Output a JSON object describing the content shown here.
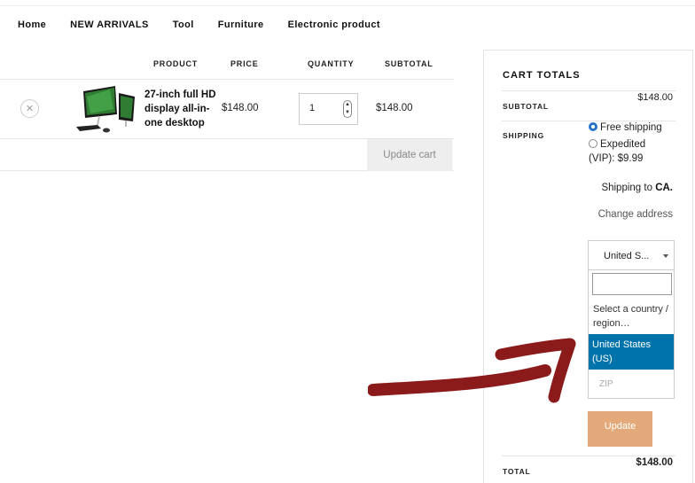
{
  "nav": {
    "items": [
      {
        "label": "Home"
      },
      {
        "label": "NEW ARRIVALS"
      },
      {
        "label": "Tool"
      },
      {
        "label": "Furniture"
      },
      {
        "label": "Electronic product"
      }
    ]
  },
  "cart": {
    "headers": {
      "product": "PRODUCT",
      "price": "PRICE",
      "quantity": "QUANTITY",
      "subtotal": "SUBTOTAL"
    },
    "items": [
      {
        "remove_icon": "close-icon",
        "name": "27-inch full HD display all-in-one desktop",
        "price": "$148.00",
        "quantity": "1",
        "subtotal": "$148.00"
      }
    ],
    "update_label": "Update cart"
  },
  "totals": {
    "title": "CART TOTALS",
    "subtotal_label": "SUBTOTAL",
    "subtotal_value": "$148.00",
    "shipping_label": "SHIPPING",
    "shipping_options": [
      {
        "label": "Free shipping",
        "selected": true
      },
      {
        "label": "Expedited (VIP): $9.99",
        "selected": false
      }
    ],
    "shipping_to_prefix": "Shipping to ",
    "shipping_to_value": "CA.",
    "change_address": "Change address",
    "country_select": {
      "selected_text": "United S...",
      "search_value": "",
      "options": [
        "Select a country / region…",
        "United States (US)"
      ],
      "highlighted": "United States (US)"
    },
    "zip_placeholder": "ZIP",
    "update_label": "Update",
    "total_label": "TOTAL",
    "total_value": "$148.00"
  },
  "colors": {
    "highlight": "#0073aa",
    "update_button": "#e3a97a",
    "arrow": "#8b1a1a",
    "radio_selected": "#2a74c7"
  }
}
